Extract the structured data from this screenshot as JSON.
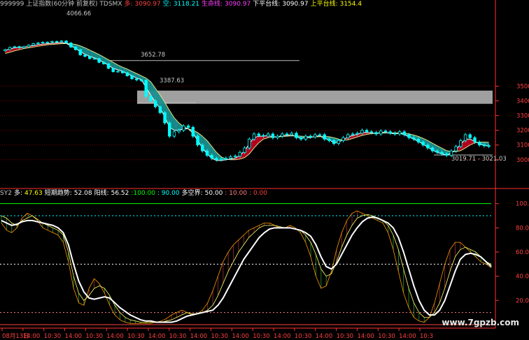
{
  "header_main": {
    "title": "999999 上证指数(60分钟 前复权) TDSMX",
    "duo_label": "多:",
    "duo_value": "3090.97",
    "kong_label": "空:",
    "kong_value": "3118.21",
    "shengming_label": "生命线:",
    "shengming_value": "3090.97",
    "xiaping_label": "下平台线:",
    "xiaping_value": "3090.97",
    "shangping_label": "上平台线:",
    "shangping_value": "3154.4"
  },
  "header_sub": {
    "title": "SY2",
    "duo_label": "多:",
    "duo_value": "47.63",
    "zhouqi_label": "短期趋势:",
    "zhouqi_value": "52.08",
    "fuzhu_label": "阳线:",
    "fuzhu_value": "56.52",
    "l100": ":100.00",
    "l90": ": 90.00",
    "duokong_label": "多空界:",
    "duokong_value": "50.00",
    "l10": ": 10.00",
    "l0": ": 0.00"
  },
  "annotations": {
    "ann_high": "4066.66",
    "ann_mid1": "3652.78",
    "ann_mid2": "3387.63",
    "ann_low": "3019.71 - 3021.03"
  },
  "watermark": "www.7gpzb.com",
  "colors": {
    "background": "#000000",
    "up_candle": "#00ffff",
    "down_candle": "#00ffff",
    "band_teal": "#1a8f8f",
    "band_red": "#c00020",
    "grid": "#7a0000",
    "gray_band": "#a0a0a0",
    "axis": "#ff3030"
  },
  "chart_data": [
    {
      "type": "candlestick",
      "title": "999999 上证指数(60分钟 前复权) TDSMX",
      "yticks": [
        3000,
        3100,
        3200,
        3300,
        3400,
        3500
      ],
      "ytick_labels": [
        "3000",
        "3100",
        "3200",
        "3300",
        "3400",
        "3500"
      ],
      "ylim": [
        2980,
        3540
      ],
      "price_levels": [
        3652.78,
        3387.63
      ],
      "gray_zone": [
        3380,
        3470
      ],
      "closes": [
        3950,
        3980,
        3990,
        3975,
        3990,
        4010,
        4030,
        4040,
        4050,
        4050,
        4060,
        4055,
        4066,
        4040,
        3985,
        3950,
        3880,
        3860,
        3830,
        3830,
        3780,
        3760,
        3700,
        3655,
        3660,
        3640,
        3600,
        3560,
        3545,
        3540,
        3430,
        3400,
        3360,
        3320,
        3250,
        3160,
        3190,
        3200,
        3230,
        3220,
        3160,
        3100,
        3060,
        3030,
        3010,
        3000,
        3005,
        3010,
        3020,
        3025,
        3050,
        3080,
        3140,
        3175,
        3165,
        3160,
        3175,
        3150,
        3160,
        3175,
        3170,
        3180,
        3150,
        3140,
        3160,
        3155,
        3170,
        3170,
        3140,
        3130,
        3110,
        3130,
        3150,
        3170,
        3175,
        3180,
        3200,
        3190,
        3185,
        3175,
        3195,
        3190,
        3180,
        3175,
        3190,
        3170,
        3150,
        3140,
        3120,
        3100,
        3080,
        3060,
        3050,
        3040,
        3030,
        3060,
        3090,
        3130,
        3170,
        3150,
        3120,
        3100,
        3095,
        3091
      ],
      "duo_line": [
        3940,
        3960,
        3975,
        3980,
        3985,
        3995,
        4005,
        4015,
        4025,
        4030,
        4035,
        4040,
        4045,
        4035,
        4000,
        3970,
        3920,
        3890,
        3860,
        3840,
        3810,
        3780,
        3740,
        3700,
        3680,
        3660,
        3630,
        3600,
        3570,
        3550,
        3490,
        3440,
        3390,
        3350,
        3290,
        3220,
        3200,
        3200,
        3210,
        3210,
        3180,
        3130,
        3080,
        3040,
        3010,
        2995,
        2995,
        3000,
        3005,
        3010,
        3030,
        3060,
        3110,
        3150,
        3160,
        3160,
        3165,
        3155,
        3155,
        3165,
        3165,
        3170,
        3155,
        3145,
        3150,
        3150,
        3160,
        3162,
        3145,
        3135,
        3115,
        3120,
        3135,
        3155,
        3165,
        3172,
        3185,
        3185,
        3182,
        3178,
        3185,
        3185,
        3180,
        3175,
        3180,
        3170,
        3155,
        3140,
        3125,
        3105,
        3085,
        3065,
        3050,
        3040,
        3030,
        3045,
        3070,
        3105,
        3140,
        3140,
        3125,
        3108,
        3098,
        3091
      ],
      "kong_line": [
        3900,
        3915,
        3935,
        3950,
        3965,
        3975,
        3985,
        3995,
        4005,
        4015,
        4020,
        4025,
        4030,
        4032,
        4030,
        4020,
        4000,
        3975,
        3945,
        3915,
        3885,
        3850,
        3815,
        3780,
        3745,
        3715,
        3690,
        3660,
        3630,
        3600,
        3570,
        3530,
        3485,
        3440,
        3390,
        3335,
        3285,
        3250,
        3225,
        3210,
        3200,
        3185,
        3160,
        3130,
        3090,
        3050,
        3020,
        3005,
        3000,
        3000,
        3005,
        3015,
        3040,
        3080,
        3115,
        3140,
        3150,
        3155,
        3155,
        3158,
        3160,
        3162,
        3162,
        3160,
        3158,
        3155,
        3155,
        3157,
        3158,
        3156,
        3150,
        3140,
        3133,
        3135,
        3145,
        3155,
        3165,
        3172,
        3177,
        3180,
        3181,
        3182,
        3183,
        3183,
        3182,
        3180,
        3176,
        3168,
        3158,
        3145,
        3130,
        3112,
        3095,
        3078,
        3062,
        3055,
        3055,
        3062,
        3080,
        3100,
        3115,
        3120,
        3120,
        3118
      ]
    },
    {
      "type": "line",
      "title": "SY2",
      "yticks": [
        20,
        40,
        60,
        80,
        100
      ],
      "ytick_labels": [
        "20.00",
        "40.00",
        "60.00",
        "80.00",
        "100.0"
      ],
      "ylim": [
        0,
        105
      ],
      "reference_lines": [
        100,
        90,
        50,
        10,
        0
      ],
      "xtick_labels": [
        "08月13日",
        "14:00",
        "10:30",
        "14:00",
        "10:30",
        "14:00",
        "10:30",
        "14:00",
        "10:30",
        "14:00",
        "10:30",
        "14:00",
        "10:30",
        "14:00",
        "10:30",
        "14:00",
        "10:30",
        "14:00",
        "10:30",
        "14:00",
        "10:3"
      ],
      "series": [
        {
          "name": "多",
          "color": "#ffffff",
          "values": [
            86,
            84,
            82,
            83,
            85,
            86,
            86,
            85,
            84,
            83,
            82,
            80,
            76,
            66,
            50,
            36,
            27,
            22,
            21,
            22,
            23,
            22,
            18,
            14,
            11,
            8,
            6,
            4,
            3,
            3,
            2,
            2,
            2,
            2,
            3,
            5,
            7,
            8,
            9,
            10,
            11,
            12,
            16,
            22,
            30,
            38,
            46,
            54,
            60,
            66,
            72,
            76,
            79,
            80,
            80,
            80,
            80,
            79,
            78,
            76,
            73,
            66,
            56,
            48,
            46,
            50,
            58,
            66,
            74,
            80,
            85,
            88,
            89,
            88,
            86,
            84,
            80,
            72,
            60,
            46,
            32,
            20,
            12,
            8,
            8,
            12,
            20,
            32,
            44,
            54,
            58,
            59,
            58,
            56,
            52,
            48
          ]
        },
        {
          "name": "短期趋势",
          "color": "#ffff66",
          "values": [
            90,
            88,
            84,
            82,
            86,
            88,
            90,
            87,
            84,
            82,
            80,
            78,
            74,
            60,
            40,
            26,
            20,
            24,
            30,
            32,
            30,
            24,
            16,
            10,
            6,
            4,
            3,
            2,
            2,
            2,
            2,
            2,
            3,
            4,
            6,
            8,
            10,
            9,
            9,
            10,
            12,
            16,
            24,
            34,
            44,
            52,
            60,
            66,
            72,
            76,
            80,
            82,
            82,
            82,
            81,
            80,
            80,
            79,
            78,
            74,
            68,
            58,
            46,
            40,
            42,
            52,
            64,
            74,
            82,
            88,
            90,
            91,
            90,
            88,
            86,
            82,
            74,
            62,
            46,
            30,
            18,
            10,
            6,
            6,
            10,
            18,
            30,
            44,
            56,
            62,
            64,
            62,
            60,
            56,
            52,
            50
          ]
        },
        {
          "name": "阳线",
          "color": "#ff9900",
          "values": [
            84,
            78,
            76,
            80,
            88,
            92,
            90,
            86,
            80,
            78,
            76,
            74,
            68,
            52,
            30,
            18,
            16,
            30,
            38,
            34,
            26,
            16,
            8,
            4,
            2,
            1,
            1,
            1,
            1,
            1,
            2,
            3,
            5,
            8,
            10,
            12,
            10,
            8,
            9,
            12,
            18,
            28,
            40,
            52,
            60,
            66,
            70,
            74,
            78,
            80,
            82,
            84,
            84,
            82,
            80,
            80,
            82,
            80,
            76,
            68,
            56,
            40,
            30,
            32,
            44,
            62,
            76,
            86,
            92,
            94,
            92,
            90,
            88,
            86,
            84,
            76,
            62,
            44,
            26,
            14,
            6,
            3,
            2,
            6,
            18,
            34,
            50,
            62,
            68,
            68,
            64,
            60,
            56,
            52,
            50,
            47
          ]
        }
      ]
    }
  ]
}
